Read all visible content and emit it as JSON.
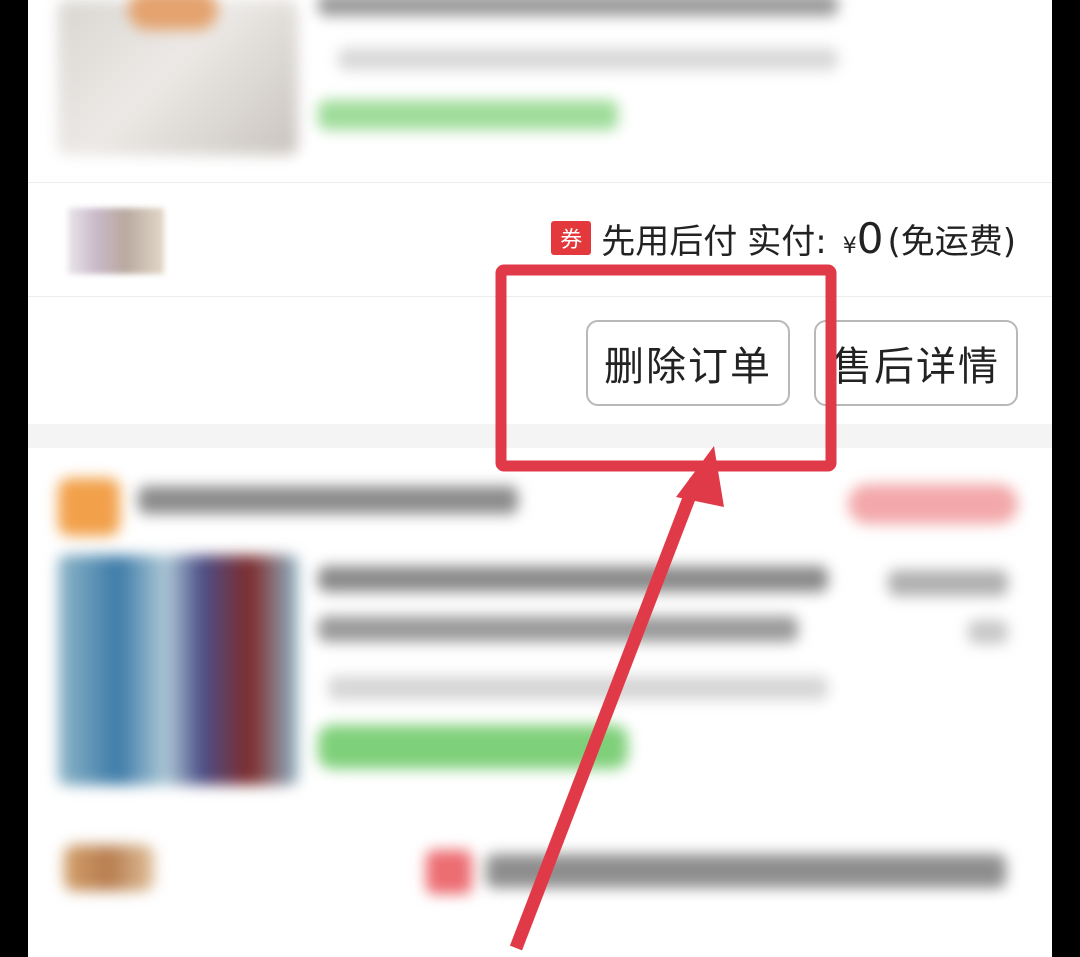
{
  "payment": {
    "coupon_label": "券",
    "method_label": "先用后付",
    "paid_label": "实付:",
    "currency": "¥",
    "amount": "0",
    "shipping_note": "(免运费)"
  },
  "actions": {
    "delete_order": "删除订单",
    "after_sale_details": "售后详情"
  },
  "colors": {
    "coupon_red": "#e4393c",
    "annotation_red": "#e03a48",
    "button_border": "#b8b8b8"
  },
  "icons": {
    "coupon": "coupon-badge-icon",
    "shop": "shop-avatar-icon"
  }
}
